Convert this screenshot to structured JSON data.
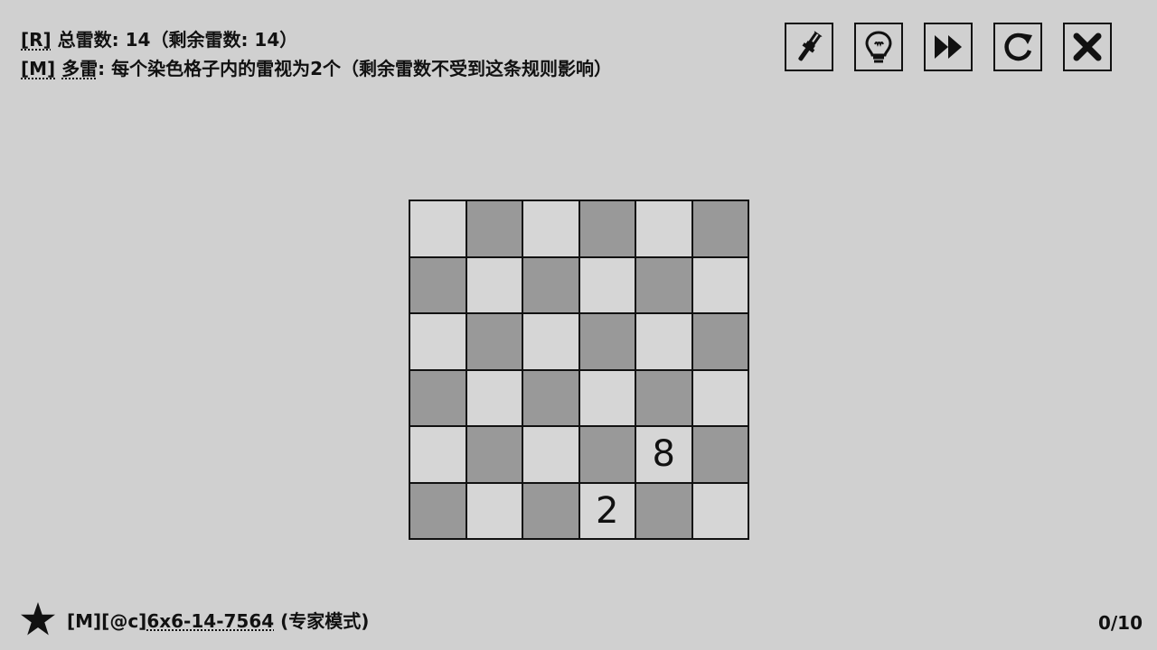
{
  "rules": {
    "line1": {
      "tag": "[R]",
      "text": " 总雷数:  14（剩余雷数: 14）"
    },
    "line2": {
      "tag": "[M]",
      "name": "多雷",
      "text": ": 每个染色格子内的雷视为2个（剩余雷数不受到这条规则影响）"
    }
  },
  "toolbar": {
    "buttons": [
      {
        "name": "brush-button",
        "icon": "brush-icon"
      },
      {
        "name": "hint-button",
        "icon": "lightbulb-icon"
      },
      {
        "name": "skip-button",
        "icon": "fast-forward-icon"
      },
      {
        "name": "restart-button",
        "icon": "restart-icon"
      },
      {
        "name": "close-button",
        "icon": "close-icon"
      }
    ]
  },
  "board": {
    "rows": 6,
    "cols": 6,
    "colors": {
      "light": "#d6d6d6",
      "dark": "#999999"
    },
    "cells": [
      [
        "",
        "",
        "",
        "",
        "",
        ""
      ],
      [
        "",
        "",
        "",
        "",
        "",
        ""
      ],
      [
        "",
        "",
        "",
        "",
        "",
        ""
      ],
      [
        "",
        "",
        "",
        "",
        "",
        ""
      ],
      [
        "",
        "",
        "",
        "",
        "8",
        ""
      ],
      [
        "",
        "",
        "",
        "2",
        "",
        ""
      ]
    ]
  },
  "footer": {
    "star_icon": "star-icon",
    "puzzle_prefix": "[M][@c]",
    "puzzle_code": "6x6-14-7564",
    "puzzle_mode": " (专家模式)",
    "progress": "0/10"
  }
}
